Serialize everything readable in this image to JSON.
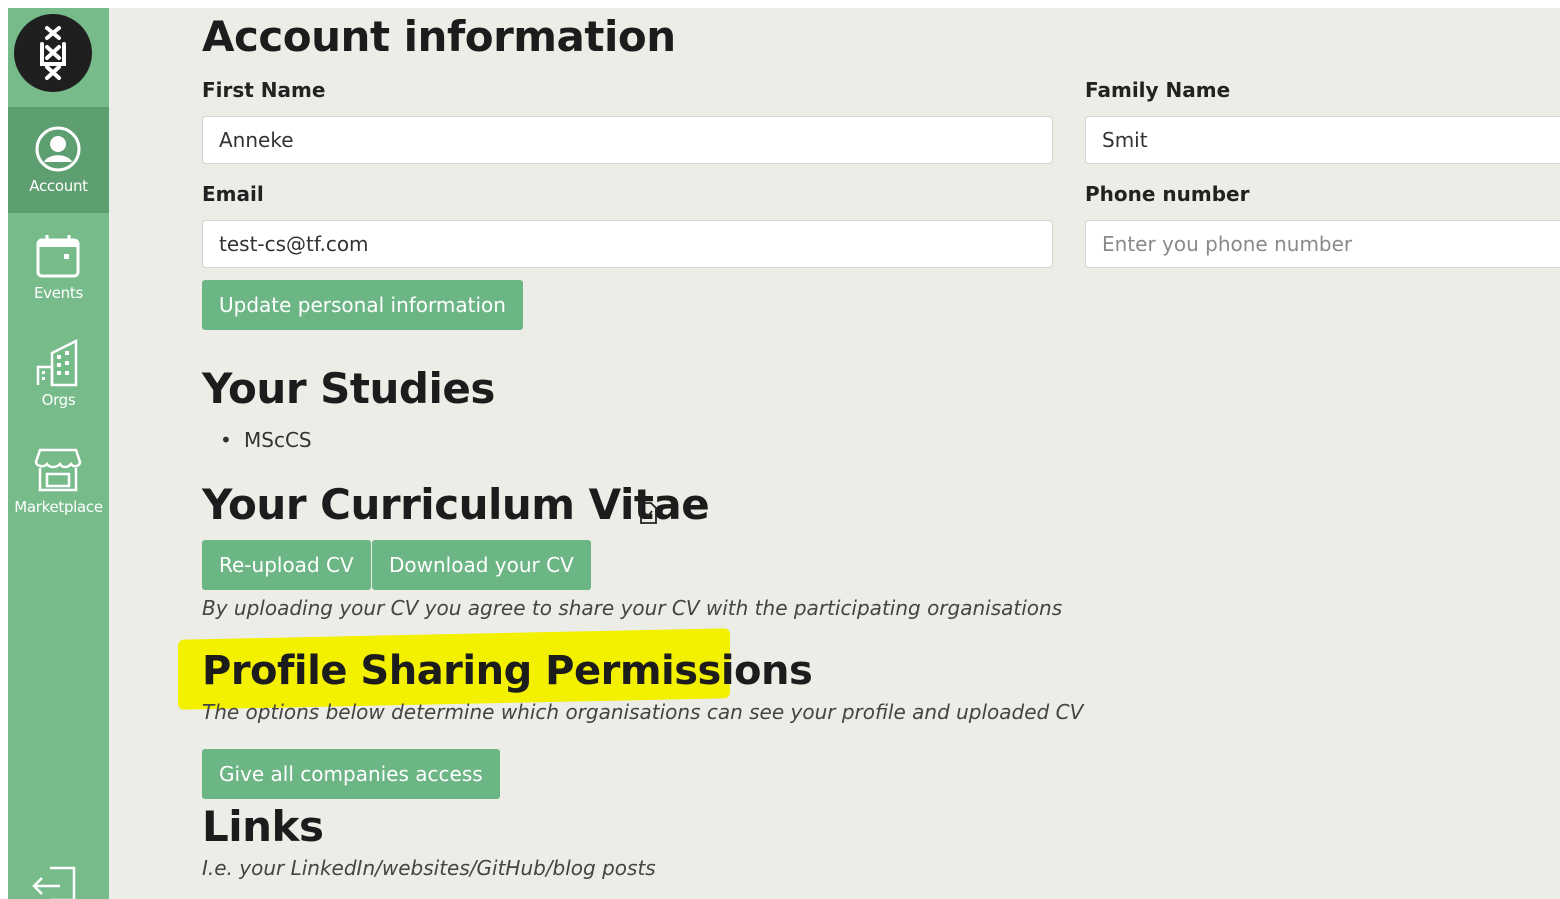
{
  "sidebar": {
    "logo_icon": "uva-logo-icon",
    "items": [
      {
        "label": "Account",
        "icon": "user-circle-icon",
        "active": true
      },
      {
        "label": "Events",
        "icon": "calendar-icon",
        "active": false
      },
      {
        "label": "Orgs",
        "icon": "building-icon",
        "active": false
      },
      {
        "label": "Marketplace",
        "icon": "storefront-icon",
        "active": false
      }
    ],
    "logout_icon": "logout-icon"
  },
  "account": {
    "title": "Account information",
    "first_name_label": "First Name",
    "first_name_value": "Anneke",
    "family_name_label": "Family Name",
    "family_name_value": "Smit",
    "email_label": "Email",
    "email_value": "test-cs@tf.com",
    "phone_label": "Phone number",
    "phone_placeholder": "Enter you phone number",
    "update_button": "Update personal information"
  },
  "studies": {
    "title": "Your Studies",
    "items": [
      "MScCS"
    ]
  },
  "cv": {
    "title": "Your Curriculum Vitae",
    "icon": "document-check-icon",
    "reupload_button": "Re-upload CV",
    "download_button": "Download your CV",
    "note": "By uploading your CV you agree to share your CV with the participating organisations"
  },
  "permissions": {
    "title": "Profile Sharing Permissions",
    "note": "The options below determine which organisations can see your profile and uploaded CV",
    "give_access_button": "Give all companies access",
    "highlight_color": "#f3f000"
  },
  "links": {
    "title": "Links",
    "note": "I.e. your LinkedIn/websites/GitHub/blog posts"
  },
  "colors": {
    "sidebar": "#77bb8b",
    "sidebar_active": "#5e9f71",
    "button": "#6cb585",
    "background": "#ecede6"
  }
}
